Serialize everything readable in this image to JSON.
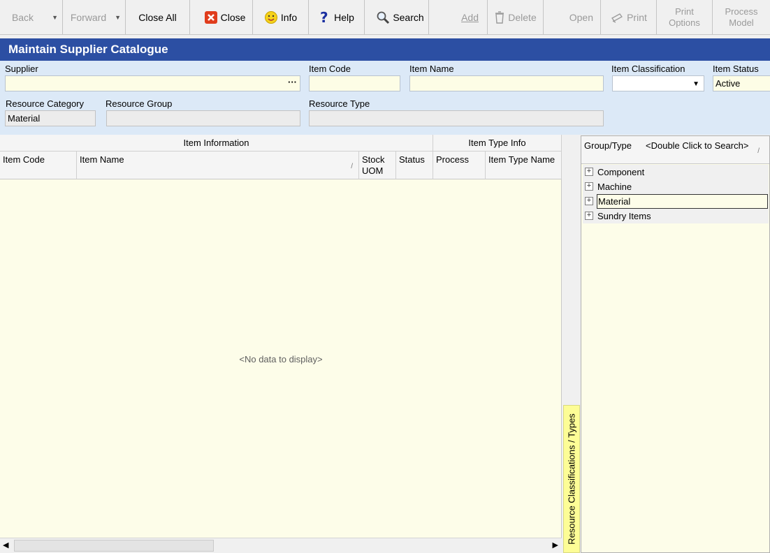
{
  "toolbar": {
    "back": "Back",
    "forward": "Forward",
    "close_all": "Close All",
    "close": "Close",
    "info": "Info",
    "help": "Help",
    "search": "Search",
    "add": "Add",
    "delete": "Delete",
    "open": "Open",
    "print": "Print",
    "print_options_1": "Print",
    "print_options_2": "Options",
    "process_model_1": "Process",
    "process_model_2": "Model"
  },
  "title": "Maintain Supplier Catalogue",
  "filters": {
    "supplier_label": "Supplier",
    "supplier_value": "",
    "item_code_label": "Item Code",
    "item_code_value": "",
    "item_name_label": "Item Name",
    "item_name_value": "",
    "item_classification_label": "Item Classification",
    "item_classification_value": "",
    "item_status_label": "Item Status",
    "item_status_value": "Active",
    "resource_category_label": "Resource Category",
    "resource_category_value": "Material",
    "resource_group_label": "Resource Group",
    "resource_group_value": "",
    "resource_type_label": "Resource Type",
    "resource_type_value": ""
  },
  "grid": {
    "band_item_info": "Item Information",
    "band_item_type_info": "Item Type Info",
    "columns": {
      "item_code": "Item Code",
      "item_name": "Item Name",
      "stock_uom_1": "Stock",
      "stock_uom_2": "UOM",
      "status": "Status",
      "process": "Process",
      "item_type_name": "Item Type Name"
    },
    "empty_text": "<No data to display>"
  },
  "side_tab": "Resource Classifications / Types",
  "tree": {
    "header": "Group/Type",
    "hint": "<Double Click to Search>",
    "nodes": [
      "Component",
      "Machine",
      "Material",
      "Sundry Items"
    ],
    "selected": "Material"
  },
  "colors": {
    "title_bar": "#2c4fa3",
    "filter_panel": "#dce9f7",
    "input_bg": "#fdfde6",
    "grid_bg": "#fdfde9",
    "side_tab": "#fdfd96",
    "close_icon": "#e03c1c",
    "info_icon": "#f6d21b",
    "help_icon": "#1a2fa0"
  },
  "icons": [
    "close-icon",
    "smiley-icon",
    "question-icon",
    "magnifier-icon",
    "bin-icon",
    "printer-icon",
    "ellipsis-icon",
    "dropdown-arrow-icon",
    "expand-plus-icon",
    "sort-icon"
  ]
}
